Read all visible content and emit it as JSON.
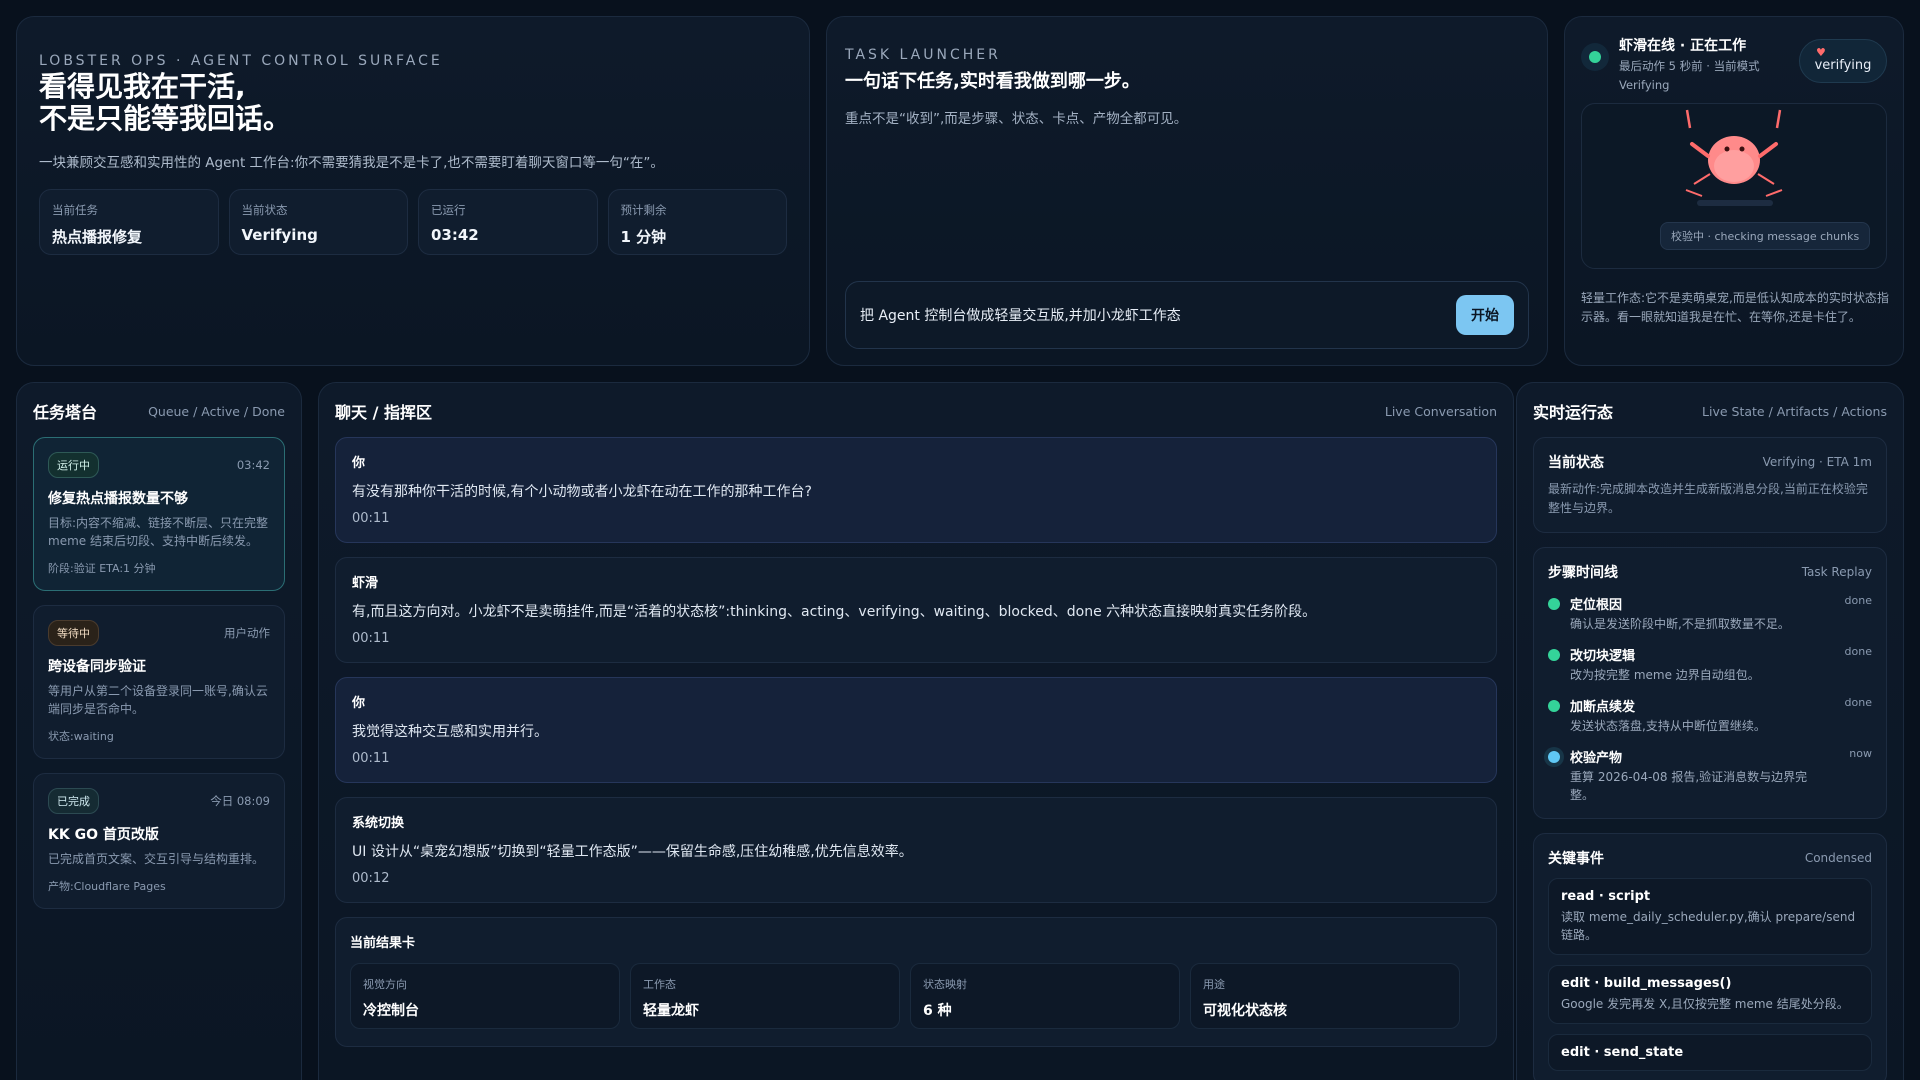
{
  "hero": {
    "eyebrow": "LOBSTER OPS · AGENT CONTROL SURFACE",
    "title_line1": "看得见我在干活,",
    "title_line2": "不是只能等我回话。",
    "description": "一块兼顾交互感和实用性的 Agent 工作台:你不需要猜我是不是卡了,也不需要盯着聊天窗口等一句“在”。",
    "stats": [
      {
        "label": "当前任务",
        "value": "热点播报修复"
      },
      {
        "label": "当前状态",
        "value": "Verifying"
      },
      {
        "label": "已运行",
        "value": "03:42"
      },
      {
        "label": "预计剩余",
        "value": "1 分钟"
      }
    ]
  },
  "launcher": {
    "eyebrow": "TASK LAUNCHER",
    "title": "一句话下任务,实时看我做到哪一步。",
    "subtitle": "重点不是“收到”,而是步骤、状态、卡点、产物全都可见。",
    "input_value": "把 Agent 控制台做成轻量交互版,并加小龙虾工作态",
    "start_label": "开始"
  },
  "status": {
    "title": "虾滑在线 · 正在工作",
    "meta_line1": "最后动作 5 秒前 · 当前模式",
    "meta_line2": "Verifying",
    "badge": "verifying",
    "caption": "校验中 · checking message chunks",
    "note": "轻量工作态:它不是卖萌桌宠,而是低认知成本的实时状态指示器。看一眼就知道我是在忙、在等你,还是卡住了。",
    "colors": {
      "online": "#34d399",
      "lobster": "#ff6b6b"
    }
  },
  "tasks": {
    "title": "任务塔台",
    "subtitle": "Queue / Active / Done",
    "items": [
      {
        "pill": "运行中",
        "right": "03:42",
        "title": "修复热点播报数量不够",
        "desc": "目标:内容不缩减、链接不断层、只在完整 meme 结束后切段、支持中断后续发。",
        "foot": "阶段:验证   ETA:1 分钟"
      },
      {
        "pill": "等待中",
        "right": "用户动作",
        "title": "跨设备同步验证",
        "desc": "等用户从第二个设备登录同一账号,确认云端同步是否命中。",
        "foot": "状态:waiting"
      },
      {
        "pill": "已完成",
        "right": "今日 08:09",
        "title": "KK GO 首页改版",
        "desc": "已完成首页文案、交互引导与结构重排。",
        "foot": "产物:Cloudflare Pages"
      }
    ]
  },
  "chat": {
    "title": "聊天 / 指挥区",
    "subtitle": "Live Conversation",
    "messages": [
      {
        "who": "你",
        "text": "有没有那种你干活的时候,有个小动物或者小龙虾在动在工作的那种工作台?",
        "time": "00:11"
      },
      {
        "who": "虾滑",
        "text": "有,而且这方向对。小龙虾不是卖萌挂件,而是“活着的状态核”:thinking、acting、verifying、waiting、blocked、done 六种状态直接映射真实任务阶段。",
        "time": "00:11"
      },
      {
        "who": "你",
        "text": "我觉得这种交互感和实用并行。",
        "time": "00:11"
      },
      {
        "who": "系统切换",
        "text": "UI 设计从“桌宠幻想版”切换到“轻量工作态版”——保留生命感,压住幼稚感,优先信息效率。",
        "time": "00:12"
      }
    ],
    "result": {
      "title": "当前结果卡",
      "cells": [
        {
          "label": "视觉方向",
          "value": "冷控制台"
        },
        {
          "label": "工作态",
          "value": "轻量龙虾"
        },
        {
          "label": "状态映射",
          "value": "6 种"
        },
        {
          "label": "用途",
          "value": "可视化状态核"
        }
      ]
    }
  },
  "runtime": {
    "title": "实时运行态",
    "subtitle": "Live State / Artifacts / Actions",
    "current": {
      "title": "当前状态",
      "right": "Verifying · ETA 1m",
      "desc": "最新动作:完成脚本改造并生成新版消息分段,当前正在校验完整性与边界。"
    },
    "timeline": {
      "title": "步骤时间线",
      "right": "Task Replay",
      "steps": [
        {
          "title": "定位根因",
          "desc": "确认是发送阶段中断,不是抓取数量不足。",
          "state": "done"
        },
        {
          "title": "改切块逻辑",
          "desc": "改为按完整 meme 边界自动组包。",
          "state": "done"
        },
        {
          "title": "加断点续发",
          "desc": "发送状态落盘,支持从中断位置继续。",
          "state": "done"
        },
        {
          "title": "校验产物",
          "desc": "重算 2026-04-08 报告,验证消息数与边界完整。",
          "state": "now"
        }
      ]
    },
    "events": {
      "title": "关键事件",
      "right": "Condensed",
      "items": [
        {
          "title": "read · script",
          "desc": "读取 meme_daily_scheduler.py,确认 prepare/send 链路。"
        },
        {
          "title": "edit · build_messages()",
          "desc": "Google 发完再发 X,且仅按完整 meme 结尾处分段。"
        },
        {
          "title": "edit · send_state",
          "desc": ""
        }
      ]
    }
  }
}
